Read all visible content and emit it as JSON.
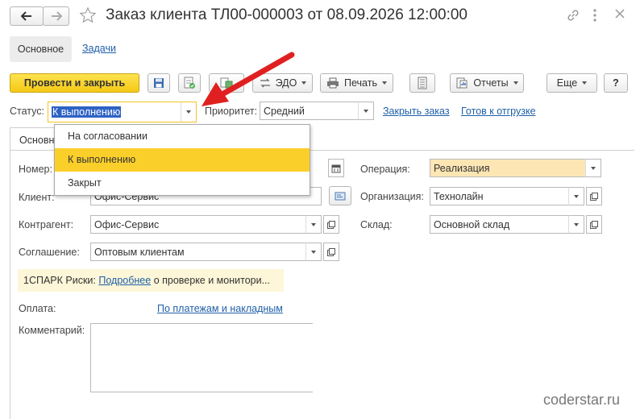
{
  "window": {
    "title": "Заказ клиента ТЛ00-000003 от 08.09.2026 12:00:00",
    "icons": [
      "back-arrow-icon",
      "forward-arrow-icon",
      "star-icon",
      "link-icon",
      "more-icon",
      "close-icon"
    ]
  },
  "tabs": [
    {
      "label": "Основное",
      "active": true
    },
    {
      "label": "Задачи",
      "active": false
    }
  ],
  "toolbar": {
    "post_close": "Провести и закрыть",
    "edo": "ЭДО",
    "print": "Печать",
    "reports": "Отчеты",
    "more": "Еще",
    "help": "?"
  },
  "status_row": {
    "status_label": "Статус:",
    "status_value": "К выполнению",
    "priority_label": "Приоритет:",
    "priority_value": "Средний",
    "close_order_link": "Закрыть заказ",
    "ready_link": "Готов к отгрузке"
  },
  "status_dropdown": {
    "options": [
      "На согласовании",
      "К выполнению",
      "Закрыт"
    ],
    "selected_index": 1
  },
  "inner_tab": {
    "label": "Основное"
  },
  "form": {
    "number_label": "Номер:",
    "client_label": "Клиент:",
    "client_value": "Офис-Сервис",
    "counterparty_label": "Контрагент:",
    "counterparty_value": "Офис-Сервис",
    "agreement_label": "Соглашение:",
    "agreement_value": "Оптовым клиентам",
    "operation_label": "Операция:",
    "operation_value": "Реализация",
    "organization_label": "Организация:",
    "organization_value": "Технолайн",
    "warehouse_label": "Склад:",
    "warehouse_value": "Основной склад"
  },
  "spark": {
    "prefix": "1СПАРК Риски:",
    "link": "Подробнее",
    "suffix": "о проверке и монитори..."
  },
  "payment": {
    "label": "Оплата:",
    "link": "По платежам и накладным"
  },
  "comment": {
    "label": "Комментарий:",
    "value": ""
  },
  "watermark": "coderstar.ru",
  "colors": {
    "accent_yellow": "#f9d126",
    "selected_bg": "#fbcf2a",
    "operation_bg": "#fde6b4",
    "link": "#1f5fa8",
    "arrow": "#e02020"
  }
}
